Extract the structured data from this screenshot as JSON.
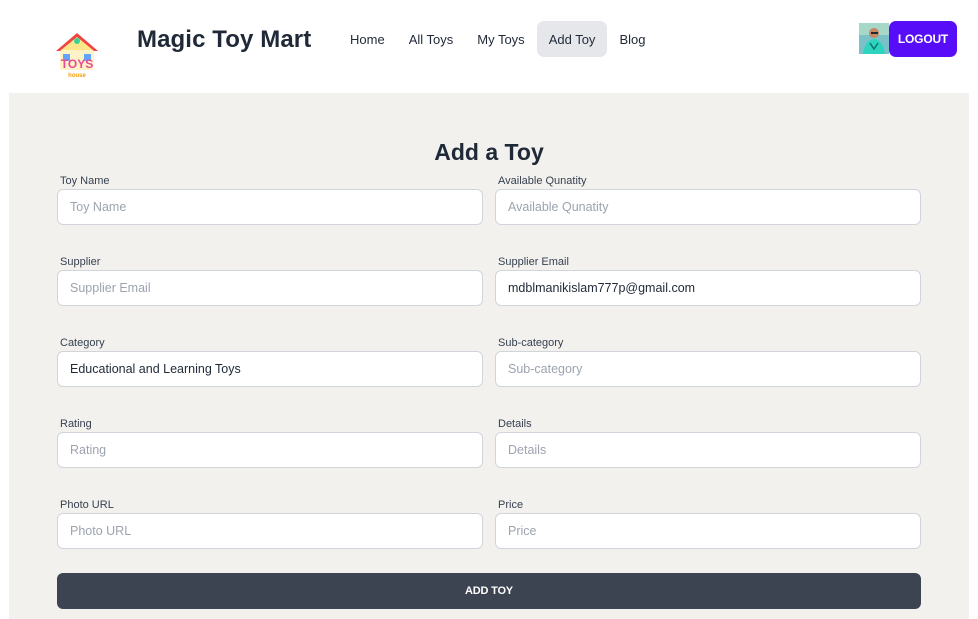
{
  "header": {
    "brand": "Magic Toy Mart",
    "logo_text": "TOYS",
    "logo_subtext": "house",
    "nav": [
      {
        "label": "Home",
        "active": false
      },
      {
        "label": "All Toys",
        "active": false
      },
      {
        "label": "My Toys",
        "active": false
      },
      {
        "label": "Add Toy",
        "active": true
      },
      {
        "label": "Blog",
        "active": false
      }
    ],
    "logout_label": "LOGOUT"
  },
  "form": {
    "title": "Add a Toy",
    "fields": [
      {
        "label": "Toy Name",
        "placeholder": "Toy Name",
        "value": ""
      },
      {
        "label": "Available Qunatity",
        "placeholder": "Available Qunatity",
        "value": ""
      },
      {
        "label": "Supplier",
        "placeholder": "Supplier Email",
        "value": ""
      },
      {
        "label": "Supplier Email",
        "placeholder": "Supplier Email",
        "value": "mdblmanikislam777p@gmail.com"
      },
      {
        "label": "Category",
        "placeholder": "Category",
        "value": "Educational and Learning Toys"
      },
      {
        "label": "Sub-category",
        "placeholder": "Sub-category",
        "value": ""
      },
      {
        "label": "Rating",
        "placeholder": "Rating",
        "value": ""
      },
      {
        "label": "Details",
        "placeholder": "Details",
        "value": ""
      },
      {
        "label": "Photo URL",
        "placeholder": "Photo URL",
        "value": ""
      },
      {
        "label": "Price",
        "placeholder": "Price",
        "value": ""
      }
    ],
    "submit_label": "ADD TOY"
  },
  "colors": {
    "primary": "#570df8",
    "submit": "#3d4451",
    "page_bg": "#f2f1ee",
    "nav_active_bg": "#e5e7eb"
  }
}
